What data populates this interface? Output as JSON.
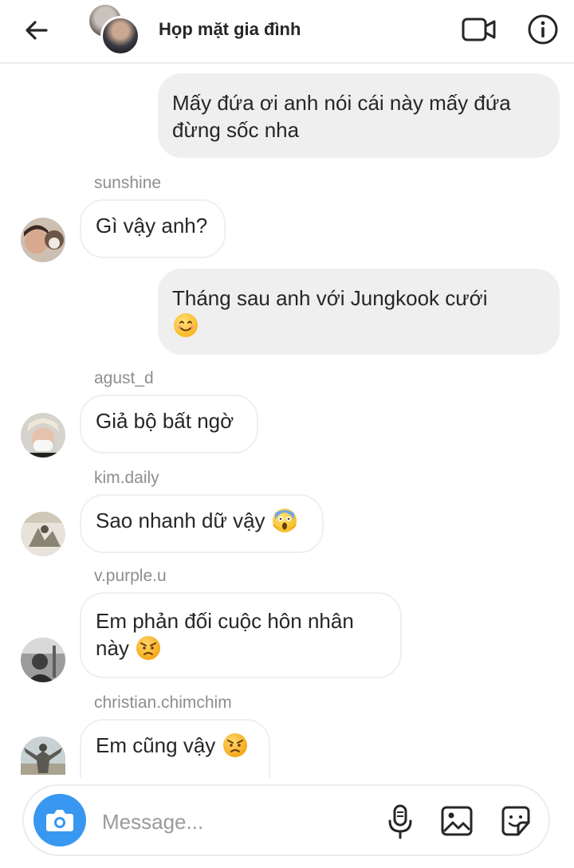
{
  "header": {
    "title": "Họp mặt gia đình"
  },
  "messages": [
    {
      "kind": "outgoing",
      "text": "Mấy đứa ơi anh nói cái này mấy đứa đừng sốc nha"
    },
    {
      "kind": "incoming",
      "sender": "sunshine",
      "text": "Gì vậy anh?"
    },
    {
      "kind": "outgoing",
      "text": "Tháng sau anh với Jungkook cưới",
      "emoji": "smiling-face-emoji"
    },
    {
      "kind": "incoming",
      "sender": "agust_d",
      "text": "Giả bộ bất ngờ"
    },
    {
      "kind": "incoming",
      "sender": "kim.daily",
      "text": "Sao nhanh dữ vậy",
      "emoji": "screaming-face-emoji"
    },
    {
      "kind": "incoming",
      "sender": "v.purple.u",
      "text": "Em phản đối cuộc hôn nhân này",
      "emoji": "angry-face-emoji"
    },
    {
      "kind": "incoming",
      "sender": "christian.chimchim",
      "text": "Em cũng vậy",
      "emoji": "angry-face-emoji"
    }
  ],
  "composer": {
    "placeholder": "Message..."
  },
  "icons": {
    "back": "back-arrow-icon",
    "video": "video-call-icon",
    "info": "info-icon",
    "camera": "camera-icon",
    "mic": "microphone-icon",
    "gallery": "gallery-icon",
    "sticker": "sticker-icon"
  },
  "colors": {
    "accent": "#3897f0",
    "outgoing_bubble": "#efefef",
    "sender_label": "#8e8e8e",
    "text": "#262626"
  }
}
